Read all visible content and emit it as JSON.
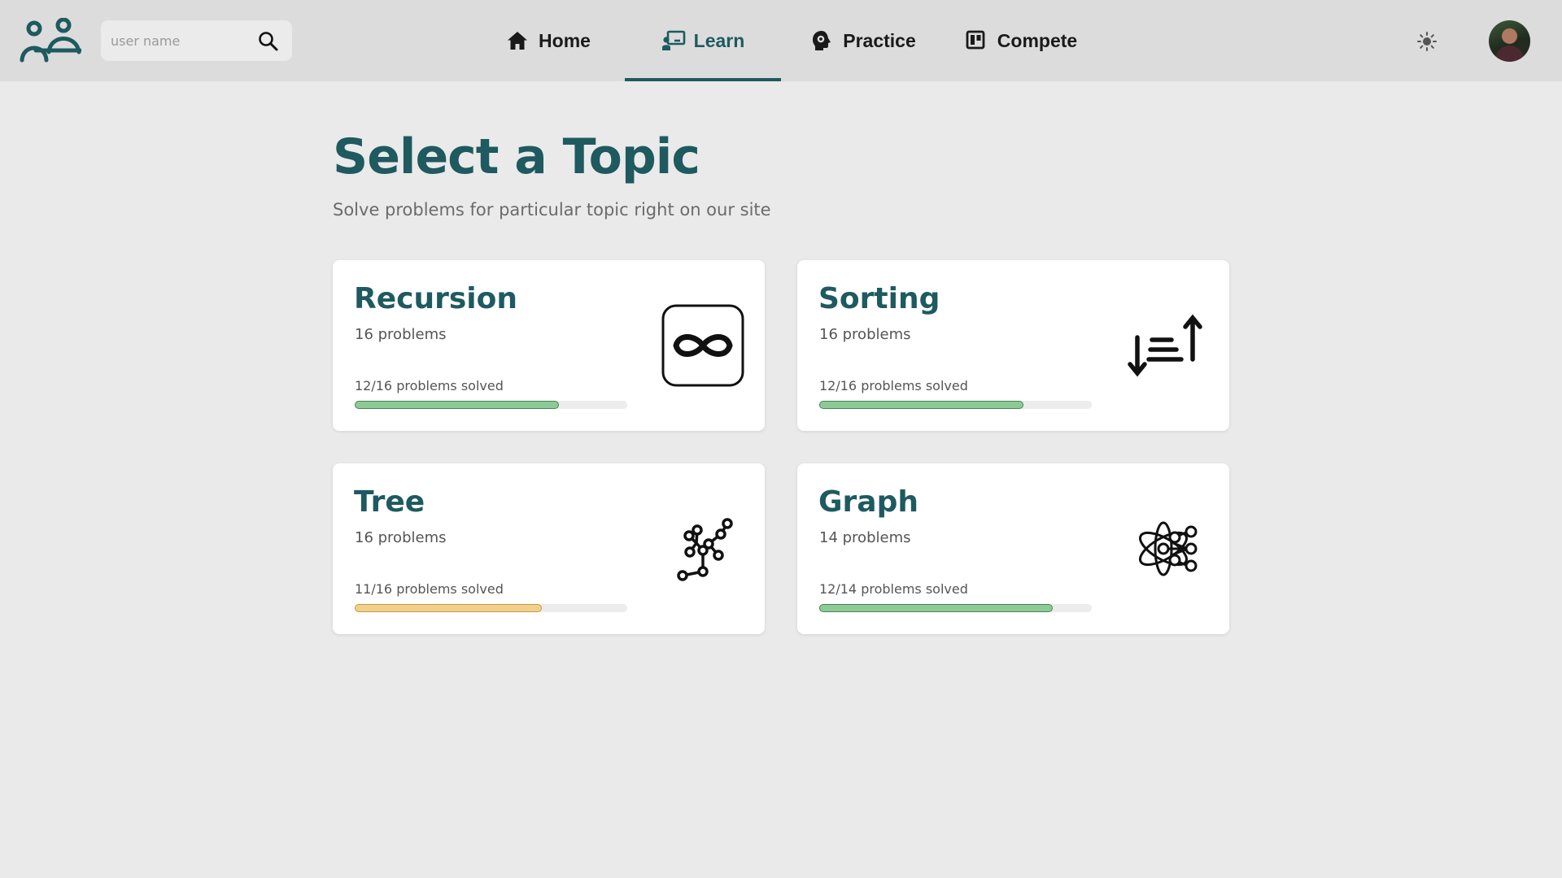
{
  "header": {
    "search": {
      "placeholder": "user name",
      "value": ""
    },
    "nav": [
      {
        "label": "Home",
        "icon": "home-icon",
        "active": false
      },
      {
        "label": "Learn",
        "icon": "teacher-board-icon",
        "active": true
      },
      {
        "label": "Practice",
        "icon": "head-gear-icon",
        "active": false
      },
      {
        "label": "Compete",
        "icon": "board-icon",
        "active": false
      }
    ],
    "theme_icon": "sun-icon",
    "accent_color": "#1e5a60"
  },
  "main": {
    "title": "Select a Topic",
    "subtitle": "Solve problems for particular topic right on our site",
    "topics": [
      {
        "title": "Recursion",
        "count": "16 problems",
        "progress_label": "12/16 problems solved",
        "solved": 12,
        "total": 16,
        "progress_color": "#8fca96",
        "icon": "infinity-icon"
      },
      {
        "title": "Sorting",
        "count": "16 problems",
        "progress_label": "12/16 problems solved",
        "solved": 12,
        "total": 16,
        "progress_color": "#8fca96",
        "icon": "sort-arrows-icon"
      },
      {
        "title": "Tree",
        "count": "16 problems",
        "progress_label": "11/16 problems solved",
        "solved": 11,
        "total": 16,
        "progress_color": "#f1d08f",
        "icon": "tree-nodes-icon"
      },
      {
        "title": "Graph",
        "count": "14 problems",
        "progress_label": "12/14 problems solved",
        "solved": 12,
        "total": 14,
        "progress_color": "#8fca96",
        "icon": "atom-network-icon"
      }
    ]
  }
}
